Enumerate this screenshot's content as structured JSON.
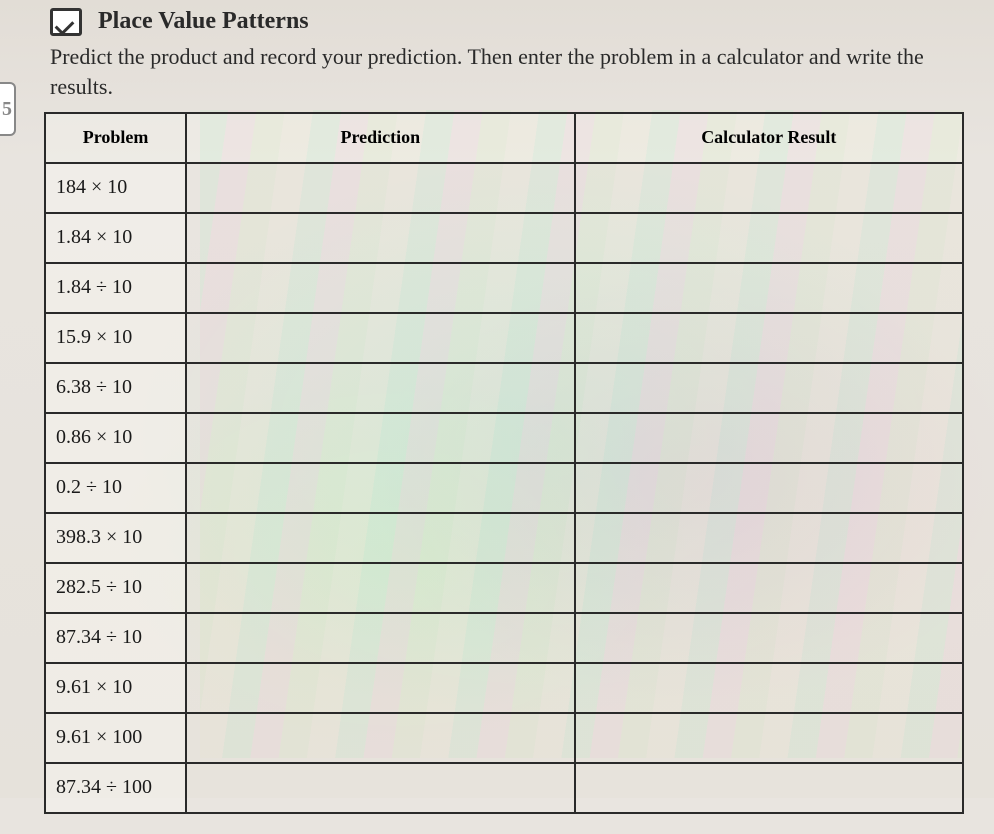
{
  "title_partial": "Place Value Patterns",
  "instructions": "Predict the product and record your prediction. Then enter the problem in a calculator and write the results.",
  "side_tab": "5",
  "headers": {
    "problem": "Problem",
    "prediction": "Prediction",
    "result": "Calculator Result"
  },
  "rows": [
    {
      "problem": "184 × 10"
    },
    {
      "problem": "1.84 × 10"
    },
    {
      "problem": "1.84 ÷ 10"
    },
    {
      "problem": "15.9 × 10"
    },
    {
      "problem": "6.38 ÷ 10"
    },
    {
      "problem": "0.86 × 10"
    },
    {
      "problem": "0.2 ÷ 10"
    },
    {
      "problem": "398.3 × 10"
    },
    {
      "problem": "282.5 ÷ 10"
    },
    {
      "problem": "87.34 ÷ 10"
    },
    {
      "problem": "9.61 × 10"
    },
    {
      "problem": "9.61 × 100"
    },
    {
      "problem": "87.34 ÷ 100"
    }
  ]
}
